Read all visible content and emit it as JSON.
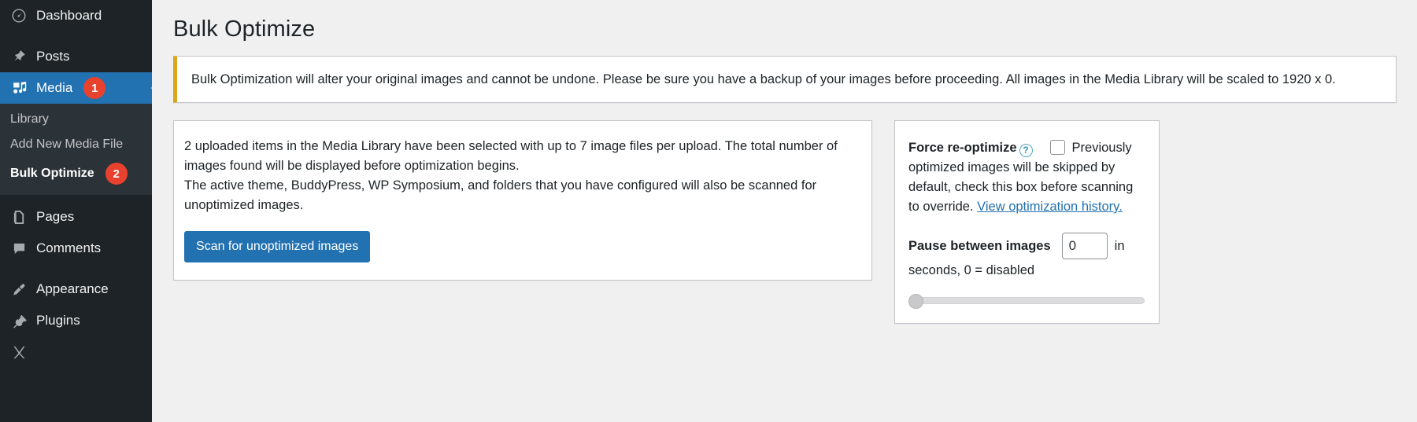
{
  "sidebar": {
    "items": [
      {
        "label": "Dashboard",
        "icon": "dashboard-icon",
        "badge": null,
        "current": false
      },
      {
        "label": "Posts",
        "icon": "pin-icon",
        "badge": null,
        "current": false
      },
      {
        "label": "Media",
        "icon": "media-icon",
        "badge": "1",
        "current": true
      }
    ],
    "submenu": [
      {
        "label": "Library",
        "badge": null,
        "active": false
      },
      {
        "label": "Add New Media File",
        "badge": null,
        "active": false
      },
      {
        "label": "Bulk Optimize",
        "badge": "2",
        "active": true
      }
    ],
    "items_after": [
      {
        "label": "Pages",
        "icon": "pages-icon",
        "badge": null,
        "current": false
      },
      {
        "label": "Comments",
        "icon": "comment-icon",
        "badge": null,
        "current": false
      },
      {
        "label": "Appearance",
        "icon": "brush-icon",
        "badge": null,
        "current": false
      },
      {
        "label": "Plugins",
        "icon": "plug-icon",
        "badge": null,
        "current": false
      }
    ]
  },
  "page": {
    "title": "Bulk Optimize"
  },
  "notice": {
    "text": "Bulk Optimization will alter your original images and cannot be undone. Please be sure you have a backup of your images before proceeding. All images in the Media Library will be scaled to 1920 x 0.",
    "accent_color": "#dba617"
  },
  "main_panel": {
    "line1": "2 uploaded items in the Media Library have been selected with up to 7 image files per upload. The total number of images found will be displayed before optimization begins.",
    "line2": "The active theme, BuddyPress, WP Symposium, and folders that you have configured will also be scanned for unoptimized images.",
    "scan_button": "Scan for unoptimized images",
    "button_color": "#2271b1"
  },
  "side_panel": {
    "force_label": "Force re-optimize",
    "help_icon_glyph": "?",
    "force_description_1": "Previously optimized images will be skipped by default, check this box before scanning to override.",
    "history_link": "View optimization history.",
    "checkbox_checked": false,
    "pause_label": "Pause between images",
    "pause_value": "0",
    "pause_unit": "in",
    "pause_sub": "seconds, 0 = disabled",
    "slider_value": 0
  }
}
